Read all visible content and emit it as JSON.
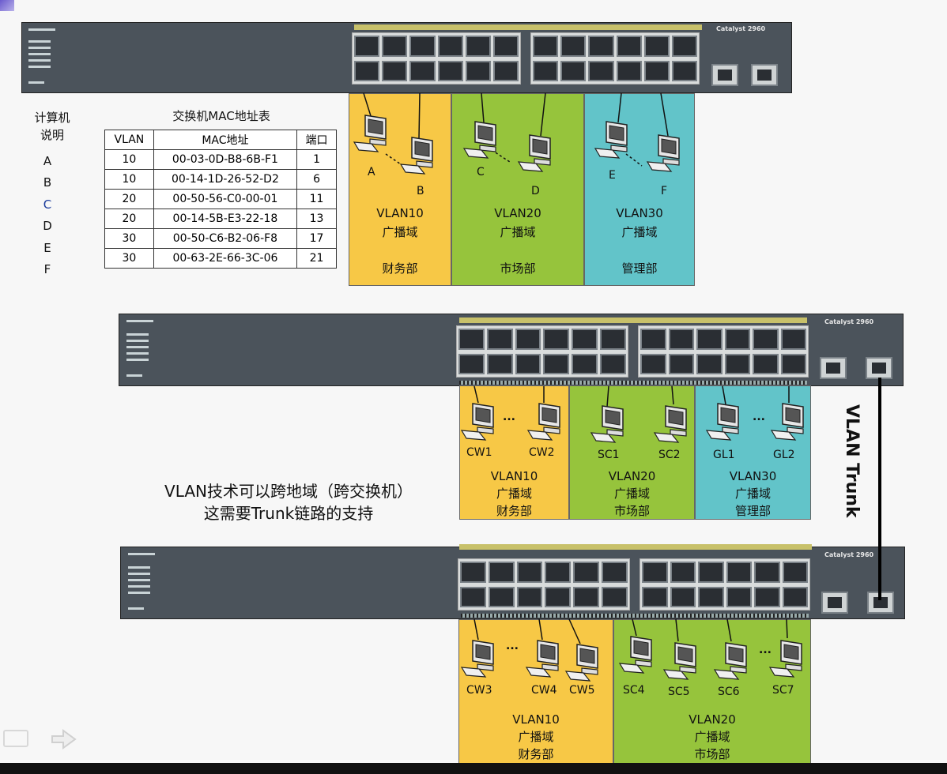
{
  "table": {
    "pc_caption": [
      "计算机",
      "说明"
    ],
    "title": "交换机MAC地址表",
    "headers": [
      "VLAN",
      "MAC地址",
      "端口"
    ],
    "rows": [
      {
        "pc": "A",
        "vlan": "10",
        "mac": "00-03-0D-B8-6B-F1",
        "port": "1"
      },
      {
        "pc": "B",
        "vlan": "10",
        "mac": "00-14-1D-26-52-D2",
        "port": "6"
      },
      {
        "pc": "C",
        "vlan": "20",
        "mac": "00-50-56-C0-00-01",
        "port": "11"
      },
      {
        "pc": "D",
        "vlan": "20",
        "mac": "00-14-5B-E3-22-18",
        "port": "13"
      },
      {
        "pc": "E",
        "vlan": "30",
        "mac": "00-50-C6-B2-06-F8",
        "port": "17"
      },
      {
        "pc": "F",
        "vlan": "30",
        "mac": "00-63-2E-66-3C-06",
        "port": "21"
      }
    ]
  },
  "switch_model": "Catalyst 2960",
  "top": {
    "pcs": [
      "A",
      "B",
      "C",
      "D",
      "E",
      "F"
    ],
    "vlans": [
      {
        "name": "VLAN10",
        "domain": "广播域",
        "dept": "财务部"
      },
      {
        "name": "VLAN20",
        "domain": "广播域",
        "dept": "市场部"
      },
      {
        "name": "VLAN30",
        "domain": "广播域",
        "dept": "管理部"
      }
    ]
  },
  "middle": {
    "pcs": [
      "CW1",
      "CW2",
      "SC1",
      "SC2",
      "GL1",
      "GL2"
    ],
    "vlans": [
      {
        "name": "VLAN10",
        "domain": "广播域",
        "dept": "财务部"
      },
      {
        "name": "VLAN20",
        "domain": "广播域",
        "dept": "市场部"
      },
      {
        "name": "VLAN30",
        "domain": "广播域",
        "dept": "管理部"
      }
    ]
  },
  "bottom": {
    "pcs": [
      "CW3",
      "CW4",
      "CW5",
      "SC4",
      "SC5",
      "SC6",
      "SC7"
    ],
    "vlans": [
      {
        "name": "VLAN10",
        "domain": "广播域",
        "dept": "财务部"
      },
      {
        "name": "VLAN20",
        "domain": "广播域",
        "dept": "市场部"
      }
    ]
  },
  "dots": "...",
  "caption": [
    "VLAN技术可以跨地域（跨交换机）",
    "这需要Trunk链路的支持"
  ],
  "trunk_label": "VLAN Trunk",
  "colors": {
    "vlan10": "#f7c846",
    "vlan20": "#96c43c",
    "vlan30": "#62c4c9"
  }
}
